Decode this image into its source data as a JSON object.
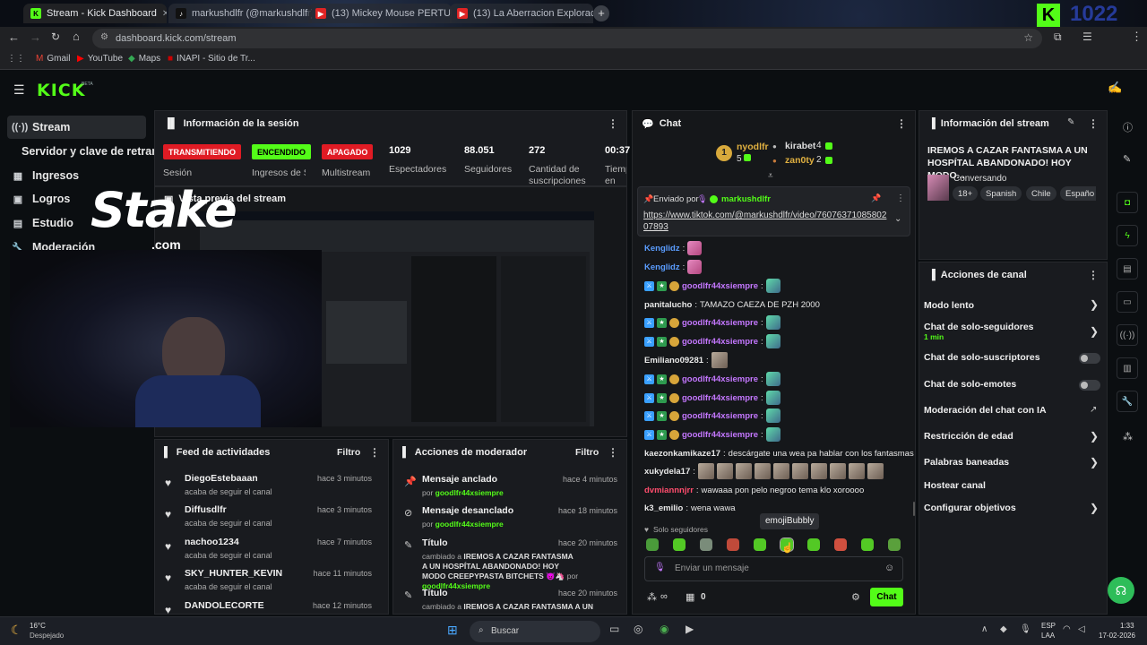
{
  "browser": {
    "tabs": [
      {
        "label": "Stream - Kick Dashboard",
        "active": true
      },
      {
        "label": "markushdlfr (@markushdlfr) |",
        "active": false
      },
      {
        "label": "(13) Mickey Mouse PERTURBA",
        "active": false
      },
      {
        "label": "(13) La Aberracion Exploracion",
        "active": false
      }
    ],
    "url": "dashboard.kick.com/stream",
    "bookmarks": [
      "Gmail",
      "YouTube",
      "Maps",
      "INAPI - Sitio de Tr..."
    ],
    "overlay_counter": "1022"
  },
  "header": {
    "logo": "KICK",
    "beta": "BETA"
  },
  "sidebar": {
    "items": [
      {
        "label": "Stream",
        "icon": "stream-icon"
      },
      {
        "label": "Servidor y clave de retransm",
        "icon": ""
      },
      {
        "label": "Ingresos",
        "icon": "income-icon"
      },
      {
        "label": "Logros",
        "icon": "trophy-icon"
      },
      {
        "label": "Estudio",
        "icon": "studio-icon"
      },
      {
        "label": "Moderación",
        "icon": "wrench-icon"
      }
    ]
  },
  "session": {
    "title": "Información de la sesión",
    "badges": [
      {
        "label": "TRANSMITIENDO",
        "sub": "Sesión",
        "color": "#e01b24"
      },
      {
        "label": "ENCENDIDO",
        "sub": "Ingresos de Sesio",
        "color": "#53fc18"
      },
      {
        "label": "APAGADO",
        "sub": "Multistream",
        "color": "#e01b24"
      }
    ],
    "stats": [
      {
        "value": "1029",
        "label": "Espectadores"
      },
      {
        "value": "88.051",
        "label": "Seguidores"
      },
      {
        "value": "272",
        "label": "Cantidad de suscripciones"
      },
      {
        "value": "00:37",
        "label": "Tiemp en viv"
      }
    ]
  },
  "preview": {
    "title": "Vista previa del stream",
    "sponsor": "Stake",
    "sponsor_sub": ".com"
  },
  "feed": {
    "title": "Feed de actividades",
    "filter": "Filtro",
    "items": [
      {
        "name": "DiegoEstebaaan",
        "sub": "acaba de seguir el canal",
        "time": "hace 3 minutos"
      },
      {
        "name": "Diffusdlfr",
        "sub": "acaba de seguir el canal",
        "time": "hace 3 minutos"
      },
      {
        "name": "nachoo1234",
        "sub": "acaba de seguir el canal",
        "time": "hace 7 minutos"
      },
      {
        "name": "SKY_HUNTER_KEVIN",
        "sub": "acaba de seguir el canal",
        "time": "hace 11 minutos"
      },
      {
        "name": "DANDOLECORTE",
        "sub": "",
        "time": "hace 12 minutos"
      }
    ]
  },
  "modactions": {
    "title": "Acciones de moderador",
    "filter": "Filtro",
    "items": [
      {
        "title": "Mensaje anclado",
        "by": "por",
        "user": "goodlfr44xsiempre",
        "time": "hace 4 minutos",
        "icon": "pin-icon"
      },
      {
        "title": "Mensaje desanclado",
        "by": "por",
        "user": "goodlfr44xsiempre",
        "time": "hace 18 minutos",
        "icon": "unpin-icon"
      },
      {
        "title": "Título",
        "by": "cambiado a",
        "detail": "IREMOS A CAZAR FANTASMA A UN HOSPÍTAL ABANDONADO! HOY MODO CREEPYPASTA BITCHETS",
        "user": "goodlfr44xsiempre",
        "time": "hace 20 minutos",
        "icon": "title-icon"
      },
      {
        "title": "Título",
        "by": "cambiado a",
        "detail": "IREMOS A CAZAR FANTASMA A UN",
        "time": "hace 20 minutos",
        "icon": "title-icon"
      }
    ]
  },
  "chat": {
    "title": "Chat",
    "top": [
      {
        "name": "nyodlfr",
        "count": "5"
      },
      {
        "name": "kirabet",
        "count": "4"
      },
      {
        "name": "zan0ty",
        "count": "2"
      }
    ],
    "pinned": {
      "label": "Enviado por",
      "user": "markushdlfr",
      "link": "https://www.tiktok.com/@markushdlfr/video/7607637108580207893"
    },
    "messages": [
      {
        "user": "Kenglidz",
        "text": "",
        "color": "#5b9dff"
      },
      {
        "user": "Kenglidz",
        "text": "",
        "color": "#5b9dff"
      },
      {
        "user": "goodlfr44xsiempre",
        "text": "",
        "color": "#c477ff"
      },
      {
        "user": "panitalucho",
        "text": "TAMAZO CAEZA DE PZH 2000",
        "color": "#ffffff"
      },
      {
        "user": "goodlfr44xsiempre",
        "text": "",
        "color": "#c477ff"
      },
      {
        "user": "goodlfr44xsiempre",
        "text": "",
        "color": "#c477ff"
      },
      {
        "user": "Emiliano09281",
        "text": "",
        "color": "#ffffff"
      },
      {
        "user": "goodlfr44xsiempre",
        "text": "",
        "color": "#c477ff"
      },
      {
        "user": "goodlfr44xsiempre",
        "text": "",
        "color": "#c477ff"
      },
      {
        "user": "goodlfr44xsiempre",
        "text": "",
        "color": "#c477ff"
      },
      {
        "user": "goodlfr44xsiempre",
        "text": "",
        "color": "#c477ff"
      },
      {
        "user": "kaezonkamikaze17",
        "text": "descárgate una wea pa hablar con los fantasmas",
        "color": "#ffffff"
      },
      {
        "user": "xukydela17",
        "text": "",
        "color": "#ffffff"
      },
      {
        "user": "dvmiannnjrr",
        "text": "wawaaa pon pelo negroo tema klo xoroooo",
        "color": "#ff4d6d"
      },
      {
        "user": "k3_emilio",
        "text": "wena wawa",
        "color": "#ffffff"
      }
    ],
    "followers_only": "Solo seguidores",
    "tooltip": "emojiBubbly",
    "input_placeholder": "Enviar un mensaje",
    "points": "0",
    "send": "Chat"
  },
  "streaminfo": {
    "title": "Información del stream",
    "stream_title": "IREMOS A CAZAR FANTASMA A UN HOSPÍTAL ABANDONADO! HOY MODO...",
    "category": "Conversando",
    "tags": [
      "18+",
      "Spanish",
      "Chile",
      "Españo"
    ]
  },
  "channel_actions": {
    "title": "Acciones de canal",
    "items": [
      {
        "label": "Modo lento",
        "control": "chevron"
      },
      {
        "label": "Chat de solo-seguidores",
        "sub": "1 min",
        "control": "chevron"
      },
      {
        "label": "Chat de solo-suscriptores",
        "control": "toggle"
      },
      {
        "label": "Chat de solo-emotes",
        "control": "toggle"
      },
      {
        "label": "Moderación del chat con IA",
        "control": "external"
      },
      {
        "label": "Restricción de edad",
        "control": "chevron"
      },
      {
        "label": "Palabras baneadas",
        "control": "chevron"
      },
      {
        "label": "Hostear canal",
        "control": "none"
      },
      {
        "label": "Configurar objetivos",
        "control": "chevron"
      }
    ]
  },
  "taskbar": {
    "weather_temp": "16°C",
    "weather_desc": "Despejado",
    "search": "Buscar",
    "lang": "ESP",
    "lang2": "LAA",
    "time": "1:33",
    "date": "17-02-2026"
  },
  "colors": {
    "accent": "#53fc18",
    "live": "#e01b24",
    "bg": "#0b0e11",
    "panel": "#191b1f"
  }
}
